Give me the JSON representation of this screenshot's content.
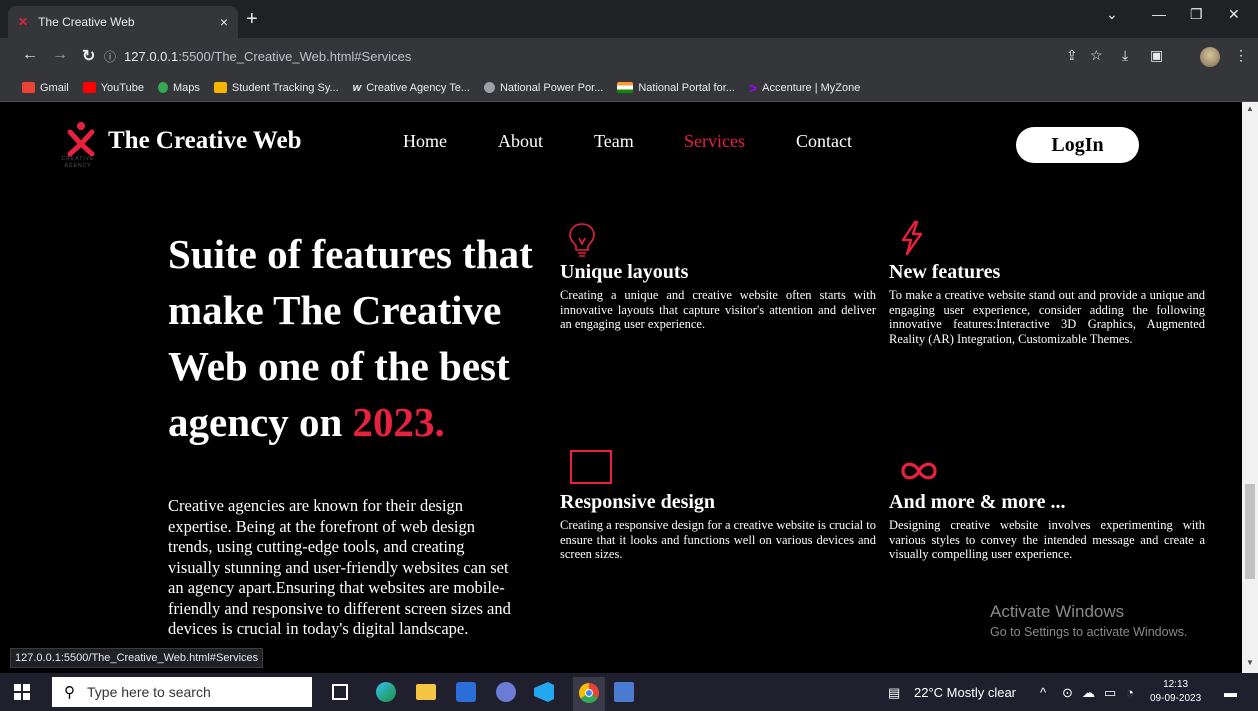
{
  "browser": {
    "tab_title": "The Creative Web",
    "tab_close": "×",
    "new_tab": "+",
    "url_host": "127.0.0.1",
    "url_rest": ":5500/The_Creative_Web.html#Services",
    "status_url": "127.0.0.1:5500/The_Creative_Web.html#Services"
  },
  "bookmarks": [
    {
      "label": "Gmail",
      "color": "#ea4335"
    },
    {
      "label": "YouTube",
      "color": "#ff0000"
    },
    {
      "label": "Maps",
      "color": "#34a853"
    },
    {
      "label": "Student Tracking Sy...",
      "color": "#f4b400"
    },
    {
      "label": "Creative Agency Te...",
      "color": "#ffffff"
    },
    {
      "label": "National Power Por...",
      "color": "#9aa0a6"
    },
    {
      "label": "National Portal for...",
      "color": "#ff9933"
    },
    {
      "label": "Accenture | MyZone",
      "color": "#a100ff"
    }
  ],
  "site": {
    "brand": "The Creative Web",
    "logo_sub": "CREATIVE AGENCY",
    "nav": [
      {
        "label": "Home"
      },
      {
        "label": "About"
      },
      {
        "label": "Team"
      },
      {
        "label": "Services"
      },
      {
        "label": "Contact"
      }
    ],
    "login_label": "LogIn",
    "headline_text": "Suite of features that make The Creative Web one of the best agency on ",
    "headline_year": "2023.",
    "intro": "Creative agencies are known for their design expertise. Being at the forefront of web design trends, using cutting-edge tools, and creating visually stunning and user-friendly websites can set an agency apart.Ensuring that websites are mobile-friendly and responsive to different screen sizes and devices is crucial in today's digital landscape.",
    "features": [
      {
        "title": "Unique layouts",
        "icon": "lightbulb-icon",
        "text": "Creating a unique and creative website often starts with innovative layouts that capture visitor's attention and deliver an engaging user experience."
      },
      {
        "title": "New features",
        "icon": "lightning-icon",
        "text": "To make a creative website stand out and provide a unique and engaging user experience, consider adding the following innovative features:Interactive 3D Graphics, Augmented Reality (AR) Integration, Customizable Themes."
      },
      {
        "title": "Responsive design",
        "icon": "square-icon",
        "text": "Creating a responsive design for a creative website is crucial to ensure that it looks and functions well on various devices and screen sizes."
      },
      {
        "title": "And more & more ...",
        "icon": "infinity-icon",
        "text": "Designing creative website involves experimenting with various styles to convey the intended message and create a visually compelling user experience."
      }
    ],
    "accent_color": "#e8213f"
  },
  "watermark": {
    "line1": "Activate Windows",
    "line2": "Go to Settings to activate Windows."
  },
  "taskbar": {
    "search_placeholder": "Type here to search",
    "weather": "22°C  Mostly clear",
    "time": "12:13",
    "date": "09-09-2023"
  }
}
